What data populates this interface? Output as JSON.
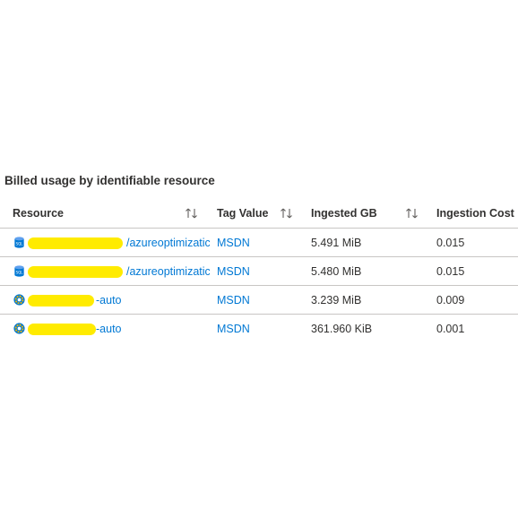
{
  "section": {
    "title": "Billed usage by identifiable resource"
  },
  "table": {
    "columns": [
      {
        "label": "Resource",
        "sortable": true
      },
      {
        "label": "Tag Value",
        "sortable": true
      },
      {
        "label": "Ingested GB",
        "sortable": true
      },
      {
        "label": "Ingestion Cost",
        "sortable": false
      }
    ],
    "rows": [
      {
        "resource_icon": "sql-database-icon",
        "resource": "/azureoptimizatic",
        "tag": "MSDN",
        "ingested": "5.491 MiB",
        "cost": "0.015"
      },
      {
        "resource_icon": "sql-database-icon",
        "resource": "/azureoptimizatic",
        "tag": "MSDN",
        "ingested": "5.480 MiB",
        "cost": "0.015"
      },
      {
        "resource_icon": "automation-account-icon",
        "resource": "-auto",
        "tag": "MSDN",
        "ingested": "3.239 MiB",
        "cost": "0.009"
      },
      {
        "resource_icon": "automation-account-icon",
        "resource": "-auto",
        "tag": "MSDN",
        "ingested": "361.960 KiB",
        "cost": "0.001"
      }
    ]
  },
  "colors": {
    "link": "#0078d4",
    "redaction": "#ffeb00",
    "divider": "#c8c6c4"
  }
}
